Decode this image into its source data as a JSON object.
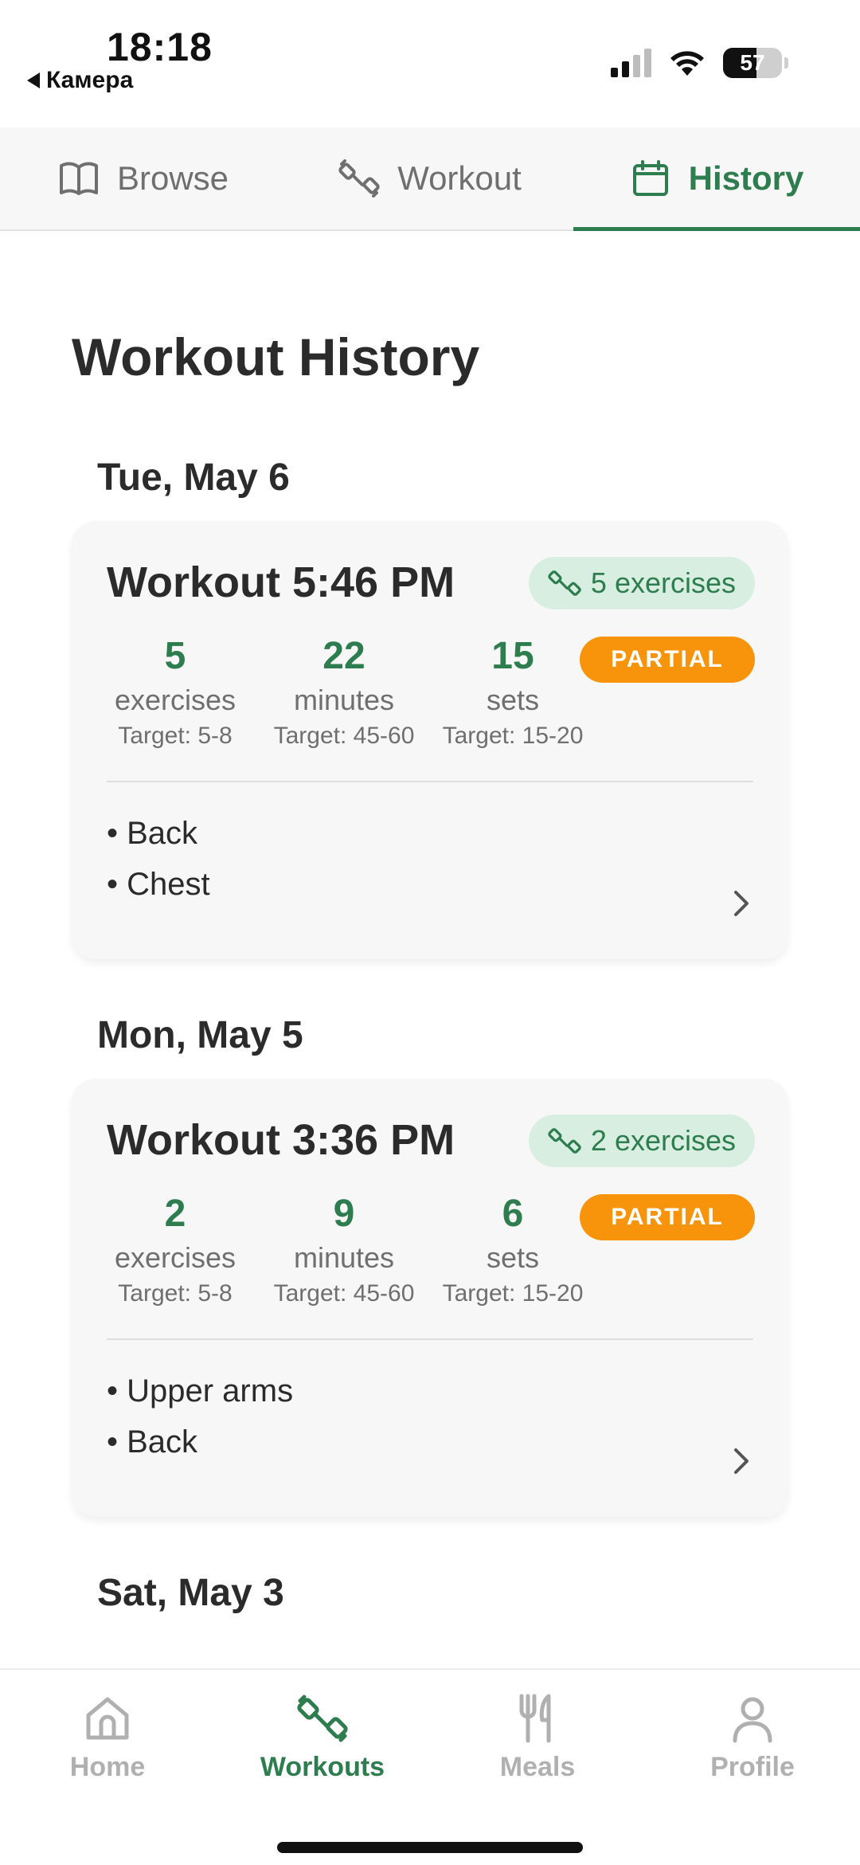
{
  "status_bar": {
    "time": "18:18",
    "back_app": "Камера",
    "battery": "57"
  },
  "top_tabs": [
    {
      "label": "Browse",
      "icon": "book-icon",
      "active": false
    },
    {
      "label": "Workout",
      "icon": "dumbbell-icon",
      "active": false
    },
    {
      "label": "History",
      "icon": "calendar-icon",
      "active": true
    }
  ],
  "page": {
    "title": "Workout History"
  },
  "days": [
    {
      "date": "Tue, May 6",
      "workout": {
        "title": "Workout 5:46 PM",
        "exercise_badge": "5 exercises",
        "status": "PARTIAL",
        "stats": [
          {
            "value": "5",
            "label": "exercises",
            "target": "Target: 5-8"
          },
          {
            "value": "22",
            "label": "minutes",
            "target": "Target: 45-60"
          },
          {
            "value": "15",
            "label": "sets",
            "target": "Target: 15-20"
          }
        ],
        "muscles": [
          "• Back",
          "• Chest"
        ]
      }
    },
    {
      "date": "Mon, May 5",
      "workout": {
        "title": "Workout 3:36 PM",
        "exercise_badge": "2 exercises",
        "status": "PARTIAL",
        "stats": [
          {
            "value": "2",
            "label": "exercises",
            "target": "Target: 5-8"
          },
          {
            "value": "9",
            "label": "minutes",
            "target": "Target: 45-60"
          },
          {
            "value": "6",
            "label": "sets",
            "target": "Target: 15-20"
          }
        ],
        "muscles": [
          "• Upper arms",
          "• Back"
        ]
      }
    },
    {
      "date": "Sat, May 3"
    }
  ],
  "bottom_nav": [
    {
      "label": "Home",
      "icon": "home-icon",
      "active": false
    },
    {
      "label": "Workouts",
      "icon": "dumbbell-icon",
      "active": true
    },
    {
      "label": "Meals",
      "icon": "fork-knife-icon",
      "active": false
    },
    {
      "label": "Profile",
      "icon": "person-icon",
      "active": false
    }
  ],
  "colors": {
    "accent": "#2e7d4f",
    "badge_bg": "#d7eee1",
    "partial": "#f7940c",
    "text": "#2b2b2b",
    "muted": "#6f6f6f"
  }
}
